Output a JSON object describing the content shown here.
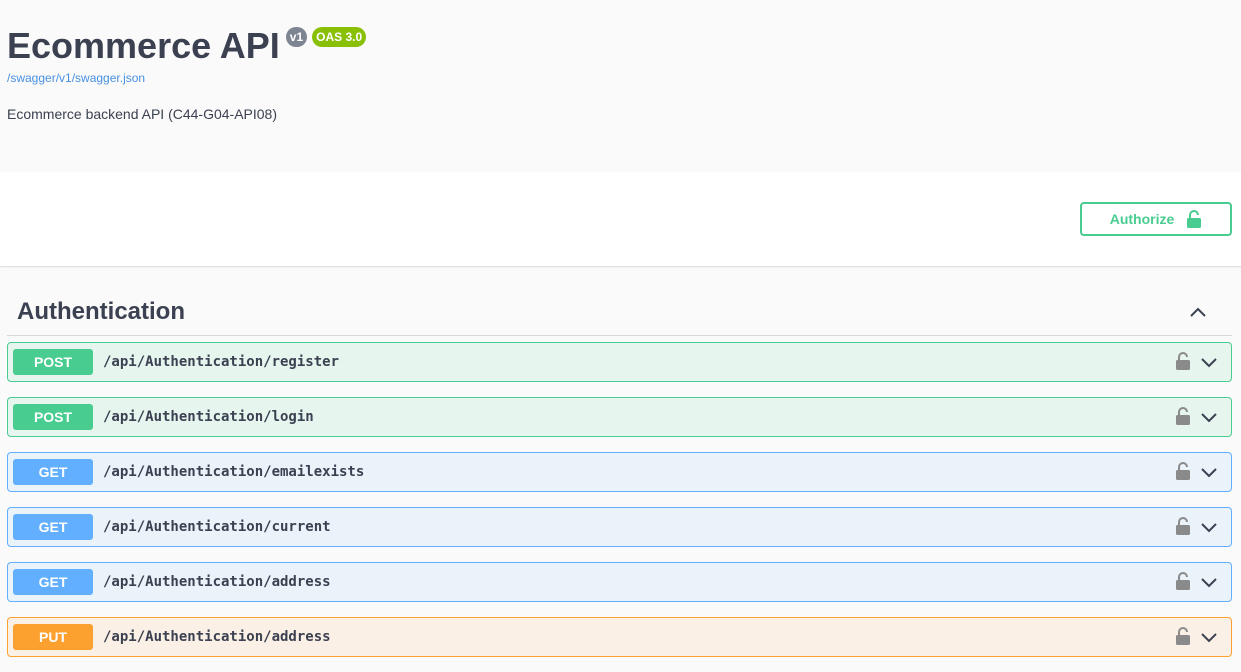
{
  "info": {
    "title": "Ecommerce API",
    "version": "v1",
    "oas": "OAS 3.0",
    "spec_url": "/swagger/v1/swagger.json",
    "description": "Ecommerce backend API (C44-G04-API08)"
  },
  "scheme": {
    "authorize_label": "Authorize"
  },
  "tag": {
    "name": "Authentication",
    "expanded": true
  },
  "operations": [
    {
      "method": "POST",
      "path": "/api/Authentication/register"
    },
    {
      "method": "POST",
      "path": "/api/Authentication/login"
    },
    {
      "method": "GET",
      "path": "/api/Authentication/emailexists"
    },
    {
      "method": "GET",
      "path": "/api/Authentication/current"
    },
    {
      "method": "GET",
      "path": "/api/Authentication/address"
    },
    {
      "method": "PUT",
      "path": "/api/Authentication/address"
    }
  ],
  "colors": {
    "post": "#49cc90",
    "get": "#61affe",
    "put": "#fca130",
    "text": "#3b4151",
    "link": "#4990e2",
    "version_badge": "#7d8492",
    "oas_badge": "#89bf04"
  },
  "icons": {
    "authorize": "unlock-icon",
    "operation_lock": "lock-icon",
    "operation_toggle": "chevron-down-icon",
    "tag_toggle": "chevron-up-icon"
  }
}
